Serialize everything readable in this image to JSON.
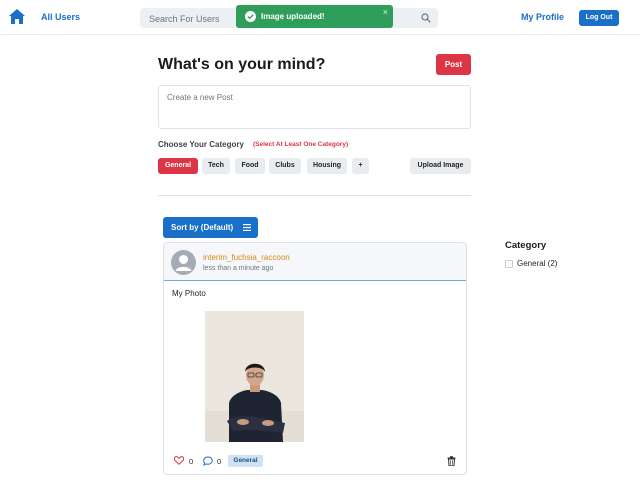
{
  "nav": {
    "all_users": "All Users",
    "search_placeholder": "Search For Users",
    "my_profile": "My Profile",
    "logout": "Log Out"
  },
  "toast": {
    "message": "Image uploaded!",
    "close": "×"
  },
  "composer": {
    "title": "What's on your mind?",
    "post_button": "Post",
    "placeholder": "Create a new Post",
    "category_label": "Choose Your Category",
    "category_hint": "(Select At Least One Category)",
    "categories": [
      "General",
      "Tech",
      "Food",
      "Clubs",
      "Housing"
    ],
    "add_category": "+",
    "upload_image": "Upload Image"
  },
  "sort": {
    "label": "Sort by (Default)"
  },
  "post": {
    "author": "interim_fuchsia_raccoon",
    "time": "less than a minute ago",
    "body": "My Photo",
    "likes": "0",
    "comments": "0",
    "tag": "General"
  },
  "sidebar": {
    "title": "Category",
    "items": [
      {
        "label": "General (2)"
      }
    ]
  },
  "colors": {
    "primary": "#1a6fc9",
    "danger": "#dc3545",
    "success": "#2e9e5a",
    "author": "#d18a1a"
  }
}
